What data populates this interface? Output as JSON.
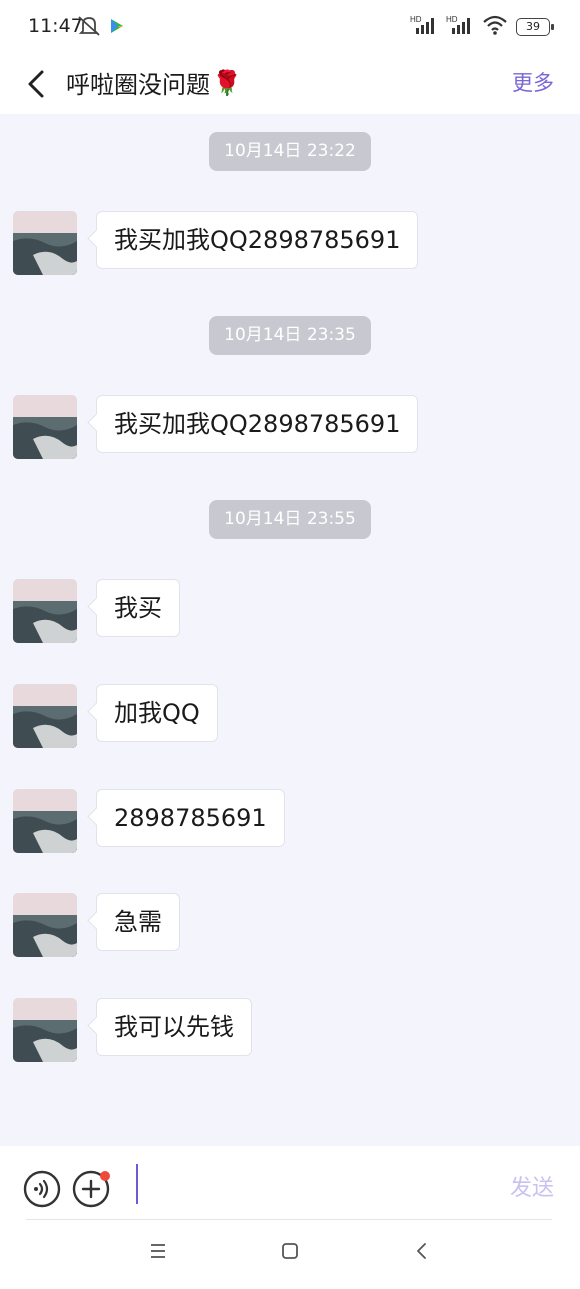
{
  "status_bar": {
    "time": "11:47",
    "battery": "39"
  },
  "header": {
    "title": "呼啦圈没问题",
    "title_emoji": "🌹",
    "more_label": "更多"
  },
  "messages": [
    {
      "type": "timestamp",
      "text": "10月14日 23:22"
    },
    {
      "type": "bubble",
      "text": "我买加我QQ2898785691"
    },
    {
      "type": "timestamp",
      "text": "10月14日 23:35"
    },
    {
      "type": "bubble",
      "text": "我买加我QQ2898785691"
    },
    {
      "type": "timestamp",
      "text": "10月14日 23:55"
    },
    {
      "type": "bubble",
      "text": "我买"
    },
    {
      "type": "bubble",
      "text": "加我QQ"
    },
    {
      "type": "bubble",
      "text": "2898785691"
    },
    {
      "type": "bubble",
      "text": "急需"
    },
    {
      "type": "bubble",
      "text": "我可以先钱"
    }
  ],
  "input_bar": {
    "input_value": "",
    "send_label": "发送"
  },
  "icons": {
    "back": "chevron-left-icon",
    "voice": "voice-icon",
    "plus": "plus-circle-icon",
    "nav_menu": "menu-icon",
    "nav_home": "home-icon",
    "nav_back": "nav-back-icon"
  },
  "colors": {
    "accent": "#7a66d8",
    "background": "#f4f4fc",
    "timestamp_pill": "#c8c8d0",
    "notification_dot": "#f04a3a"
  }
}
